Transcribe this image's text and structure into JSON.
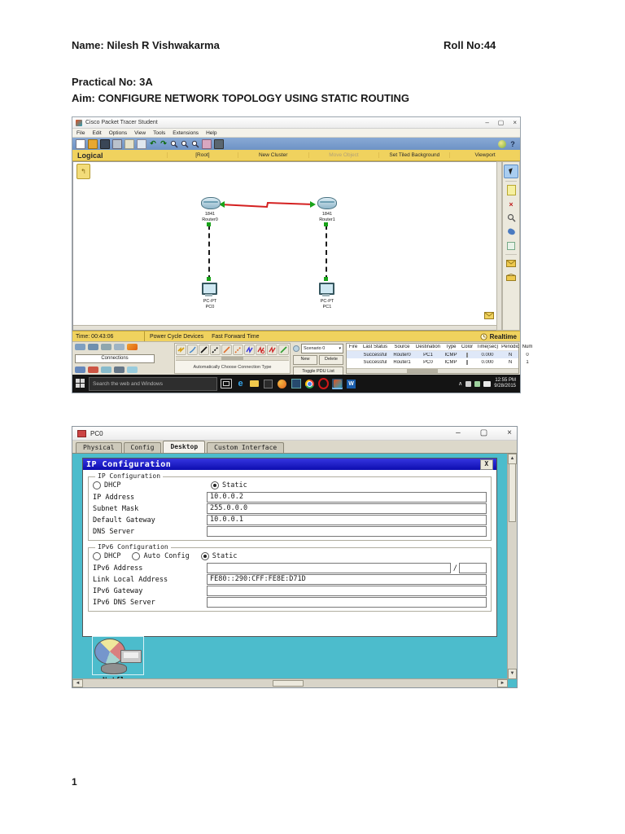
{
  "document": {
    "name": "Name: Nilesh R  Vishwakarma",
    "roll": "Roll No:44",
    "practical": "Practical No: 3A",
    "aim": "Aim: CONFIGURE NETWORK TOPOLOGY USING STATIC ROUTING",
    "page_number": "1"
  },
  "pt": {
    "title": "Cisco Packet Tracer Student",
    "window_controls": {
      "minimize": "–",
      "maximize": "▢",
      "close": "×"
    },
    "menus": [
      "File",
      "Edit",
      "Options",
      "View",
      "Tools",
      "Extensions",
      "Help"
    ],
    "help_icon": "?",
    "navbar": {
      "logical": "Logical",
      "root": "[Root]",
      "new_cluster": "New Cluster",
      "move_object": "Move Object",
      "set_tiled_background": "Set Tiled Background",
      "viewport": "Viewport"
    },
    "devices": {
      "router0_model": "1841",
      "router0_name": "Router0",
      "router1_model": "1841",
      "router1_name": "Router1",
      "pc0_model": "PC-PT",
      "pc0_name": "PC0",
      "pc1_model": "PC-PT",
      "pc1_name": "PC1"
    },
    "link_color": "#d42020",
    "status_green": "#19a319",
    "sidebar_icons": [
      "select",
      "place-note",
      "delete",
      "inspect",
      "draw-polygon",
      "resize-shape",
      "add-simple-pdu",
      "add-complex-pdu"
    ],
    "timebar": {
      "time": "Time: 00:43:06",
      "power_cycle": "Power Cycle Devices",
      "fast_forward": "Fast Forward Time",
      "mode": "Realtime"
    },
    "bottom": {
      "connections_label": "Connections",
      "auto_choose": "Automatically Choose Connection Type",
      "scenario": "Scenario 0",
      "new": "New",
      "delete": "Delete",
      "toggle_pdu": "Toggle PDU List Window",
      "pdu_headers": [
        "Fire",
        "Last Status",
        "Source",
        "Destination",
        "Type",
        "Color",
        "Time(sec)",
        "Periodic",
        "Num"
      ],
      "pdu_rows": [
        {
          "status": "Successful",
          "source": "Router0",
          "destination": "PC1",
          "type": "ICMP",
          "color": "#bb7fd4",
          "time": "0.000",
          "periodic": "N",
          "num": "0"
        },
        {
          "status": "Successful",
          "source": "Router1",
          "destination": "PC0",
          "type": "ICMP",
          "color": "#2436c8",
          "time": "0.000",
          "periodic": "N",
          "num": "1"
        }
      ]
    }
  },
  "taskbar": {
    "search_placeholder": "Search the web and Windows",
    "icons": [
      "task-view",
      "edge",
      "file-explorer",
      "store",
      "firefox",
      "photos",
      "chrome",
      "opera",
      "packet-tracer",
      "word"
    ],
    "time": "12:55 PM",
    "date": "9/28/2015"
  },
  "pc": {
    "title": "PC0",
    "tabs": [
      "Physical",
      "Config",
      "Desktop",
      "Custom Interface"
    ],
    "active_tab": "Desktop",
    "dialog": {
      "title": "IP Configuration",
      "close": "X",
      "group_ip": "IP Configuration",
      "radio_dhcp": "DHCP",
      "radio_static": "Static",
      "radio_auto": "Auto Config",
      "ip_address_label": "IP Address",
      "ip_address": "10.0.0.2",
      "subnet_label": "Subnet Mask",
      "subnet": "255.0.0.0",
      "gateway_label": "Default Gateway",
      "gateway": "10.0.0.1",
      "dns_label": "DNS Server",
      "dns": "",
      "group_ipv6": "IPv6 Configuration",
      "ipv6_address_label": "IPv6 Address",
      "ipv6_address": "",
      "ipv6_slash": "/",
      "ipv6_prefix": "",
      "link_local_label": "Link Local Address",
      "link_local": "FE80::290:CFF:FE8E:D71D",
      "ipv6_gateway_label": "IPv6 Gateway",
      "ipv6_gateway": "",
      "ipv6_dns_label": "IPv6 DNS Server",
      "ipv6_dns": ""
    },
    "netflow_label": "Netflow"
  }
}
